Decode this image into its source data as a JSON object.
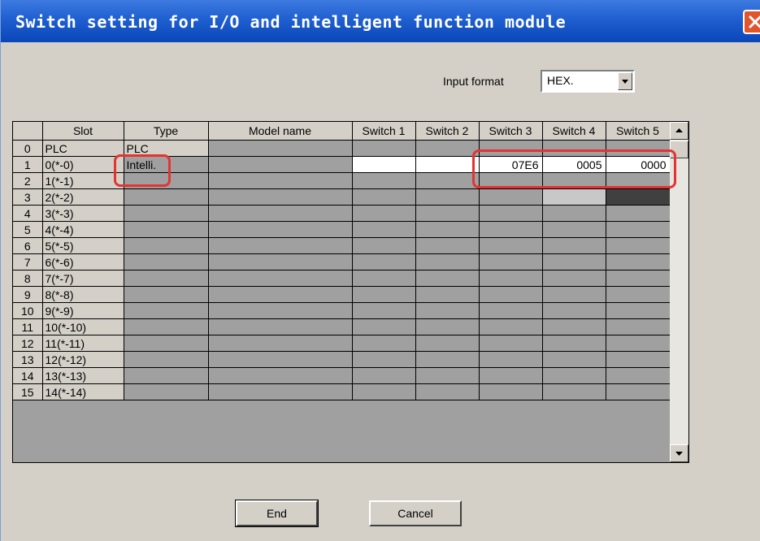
{
  "window": {
    "title": "Switch setting for I/O and intelligent function module",
    "close_icon": "close-icon"
  },
  "input_format": {
    "label": "Input format",
    "value": "HEX."
  },
  "grid": {
    "columns": [
      "",
      "Slot",
      "Type",
      "Model name",
      "Switch 1",
      "Switch 2",
      "Switch 3",
      "Switch 4",
      "Switch 5"
    ],
    "rows": [
      {
        "num": "0",
        "slot": "PLC",
        "type": "PLC",
        "model": "",
        "s1": "",
        "s2": "",
        "s3": "",
        "s4": "",
        "s5": ""
      },
      {
        "num": "1",
        "slot": "0(*-0)",
        "type": "Intelli.",
        "model": "",
        "s1": "",
        "s2": "",
        "s3": "07E6",
        "s4": "0005",
        "s5": "0000"
      },
      {
        "num": "2",
        "slot": "1(*-1)",
        "type": "",
        "model": "",
        "s1": "",
        "s2": "",
        "s3": "",
        "s4": "",
        "s5": ""
      },
      {
        "num": "3",
        "slot": "2(*-2)",
        "type": "",
        "model": "",
        "s1": "",
        "s2": "",
        "s3": "",
        "s4": "",
        "s5": ""
      },
      {
        "num": "4",
        "slot": "3(*-3)",
        "type": "",
        "model": "",
        "s1": "",
        "s2": "",
        "s3": "",
        "s4": "",
        "s5": ""
      },
      {
        "num": "5",
        "slot": "4(*-4)",
        "type": "",
        "model": "",
        "s1": "",
        "s2": "",
        "s3": "",
        "s4": "",
        "s5": ""
      },
      {
        "num": "6",
        "slot": "5(*-5)",
        "type": "",
        "model": "",
        "s1": "",
        "s2": "",
        "s3": "",
        "s4": "",
        "s5": ""
      },
      {
        "num": "7",
        "slot": "6(*-6)",
        "type": "",
        "model": "",
        "s1": "",
        "s2": "",
        "s3": "",
        "s4": "",
        "s5": ""
      },
      {
        "num": "8",
        "slot": "7(*-7)",
        "type": "",
        "model": "",
        "s1": "",
        "s2": "",
        "s3": "",
        "s4": "",
        "s5": ""
      },
      {
        "num": "9",
        "slot": "8(*-8)",
        "type": "",
        "model": "",
        "s1": "",
        "s2": "",
        "s3": "",
        "s4": "",
        "s5": ""
      },
      {
        "num": "10",
        "slot": "9(*-9)",
        "type": "",
        "model": "",
        "s1": "",
        "s2": "",
        "s3": "",
        "s4": "",
        "s5": ""
      },
      {
        "num": "11",
        "slot": "10(*-10)",
        "type": "",
        "model": "",
        "s1": "",
        "s2": "",
        "s3": "",
        "s4": "",
        "s5": ""
      },
      {
        "num": "12",
        "slot": "11(*-11)",
        "type": "",
        "model": "",
        "s1": "",
        "s2": "",
        "s3": "",
        "s4": "",
        "s5": ""
      },
      {
        "num": "13",
        "slot": "12(*-12)",
        "type": "",
        "model": "",
        "s1": "",
        "s2": "",
        "s3": "",
        "s4": "",
        "s5": ""
      },
      {
        "num": "14",
        "slot": "13(*-13)",
        "type": "",
        "model": "",
        "s1": "",
        "s2": "",
        "s3": "",
        "s4": "",
        "s5": ""
      },
      {
        "num": "15",
        "slot": "14(*-14)",
        "type": "",
        "model": "",
        "s1": "",
        "s2": "",
        "s3": "",
        "s4": "",
        "s5": ""
      }
    ]
  },
  "buttons": {
    "end": "End",
    "cancel": "Cancel"
  },
  "colors": {
    "title_bar": "#0a46b8",
    "highlight": "#e53333",
    "dialog_bg": "#d4d0c8",
    "grid_cell": "#a0a0a0"
  }
}
